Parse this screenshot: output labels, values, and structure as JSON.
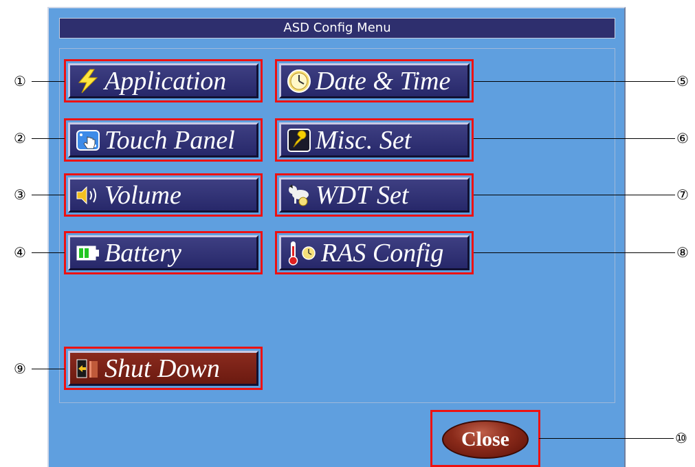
{
  "window": {
    "title": "ASD Config Menu"
  },
  "buttons": {
    "application": "Application",
    "date_time": "Date & Time",
    "touch_panel": "Touch Panel",
    "misc_set": "Misc. Set",
    "volume": "Volume",
    "wdt_set": "WDT Set",
    "battery": "Battery",
    "ras_config": "RAS Config",
    "shut_down": "Shut Down",
    "close": "Close"
  },
  "callouts": [
    "①",
    "②",
    "③",
    "④",
    "⑤",
    "⑥",
    "⑦",
    "⑧",
    "⑨",
    "⑩"
  ],
  "colors": {
    "accent_red": "#ee1111",
    "button_face": "#2e2f72",
    "window_bg": "#5f9fdf",
    "shutdown_face": "#7a2216"
  },
  "icons": {
    "application": "lightning-icon",
    "date_time": "clock-icon",
    "touch_panel": "touch-hand-icon",
    "misc_set": "wrench-icon",
    "volume": "speaker-icon",
    "wdt_set": "dog-icon",
    "battery": "battery-icon",
    "ras_config": "thermometer-clock-icon",
    "shut_down": "exit-door-icon"
  }
}
